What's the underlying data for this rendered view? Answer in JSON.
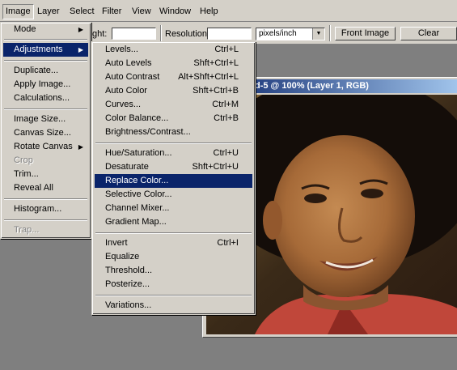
{
  "menubar": {
    "items": [
      {
        "label": "Image"
      },
      {
        "label": "Layer"
      },
      {
        "label": "Select"
      },
      {
        "label": "Filter"
      },
      {
        "label": "View"
      },
      {
        "label": "Window"
      },
      {
        "label": "Help"
      }
    ]
  },
  "options": {
    "height_label": "ght:",
    "height_value": "",
    "resolution_label": "Resolution:",
    "resolution_value": "",
    "resolution_unit": "pixels/inch",
    "front_image_label": "Front Image",
    "clear_label": "Clear"
  },
  "document": {
    "title": "d-5 @ 100% (Layer 1, RGB)"
  },
  "image_menu": {
    "items": [
      {
        "label": "Mode",
        "submenu": true
      },
      {
        "label": "Adjustments",
        "submenu": true,
        "selected": true
      },
      {
        "label": "Duplicate..."
      },
      {
        "label": "Apply Image..."
      },
      {
        "label": "Calculations..."
      },
      {
        "label": "Image Size..."
      },
      {
        "label": "Canvas Size..."
      },
      {
        "label": "Rotate Canvas",
        "submenu": true
      },
      {
        "label": "Crop",
        "disabled": true
      },
      {
        "label": "Trim..."
      },
      {
        "label": "Reveal All"
      },
      {
        "label": "Histogram..."
      },
      {
        "label": "Trap...",
        "disabled": true
      }
    ]
  },
  "adjustments_menu": {
    "items": [
      {
        "label": "Levels...",
        "shortcut": "Ctrl+L"
      },
      {
        "label": "Auto Levels",
        "shortcut": "Shft+Ctrl+L"
      },
      {
        "label": "Auto Contrast",
        "shortcut": "Alt+Shft+Ctrl+L"
      },
      {
        "label": "Auto Color",
        "shortcut": "Shft+Ctrl+B"
      },
      {
        "label": "Curves...",
        "shortcut": "Ctrl+M"
      },
      {
        "label": "Color Balance...",
        "shortcut": "Ctrl+B"
      },
      {
        "label": "Brightness/Contrast...",
        "shortcut": ""
      },
      {
        "label": "Hue/Saturation...",
        "shortcut": "Ctrl+U"
      },
      {
        "label": "Desaturate",
        "shortcut": "Shft+Ctrl+U"
      },
      {
        "label": "Replace Color...",
        "shortcut": "",
        "selected": true
      },
      {
        "label": "Selective Color...",
        "shortcut": ""
      },
      {
        "label": "Channel Mixer...",
        "shortcut": ""
      },
      {
        "label": "Gradient Map...",
        "shortcut": ""
      },
      {
        "label": "Invert",
        "shortcut": "Ctrl+I"
      },
      {
        "label": "Equalize",
        "shortcut": ""
      },
      {
        "label": "Threshold...",
        "shortcut": ""
      },
      {
        "label": "Posterize...",
        "shortcut": ""
      },
      {
        "label": "Variations...",
        "shortcut": ""
      }
    ]
  },
  "colors": {
    "workspace": "#7f7f7f",
    "chrome": "#d4d0c8",
    "selection": "#0a246a",
    "titlebar_start": "#0a246a",
    "titlebar_end": "#a6caf0"
  }
}
